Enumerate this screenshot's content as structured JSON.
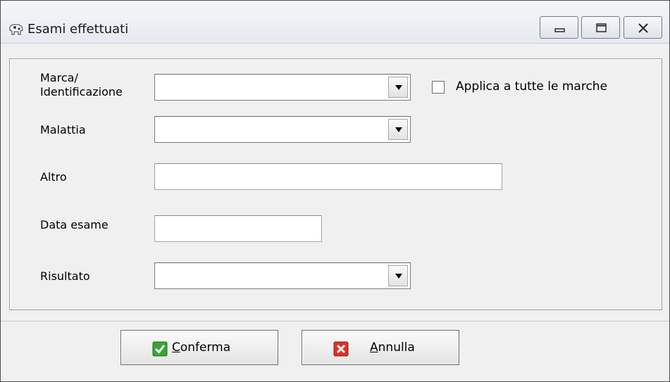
{
  "window": {
    "title": "Esami effettuati"
  },
  "form": {
    "marca_label_line1": "Marca/",
    "marca_label_line2": "Identificazione",
    "marca_value": "",
    "applica_label": "Applica a tutte le marche",
    "applica_checked": false,
    "malattia_label": "Malattia",
    "malattia_value": "",
    "altro_label": "Altro",
    "altro_value": "",
    "data_label": "Data esame",
    "data_value": "",
    "risultato_label": "Risultato",
    "risultato_value": ""
  },
  "buttons": {
    "confirm_accel": "C",
    "confirm_rest": "onferma",
    "cancel_accel": "A",
    "cancel_rest": "nnulla"
  },
  "colors": {
    "confirm_icon": "#3aa335",
    "cancel_icon": "#d9332b"
  }
}
